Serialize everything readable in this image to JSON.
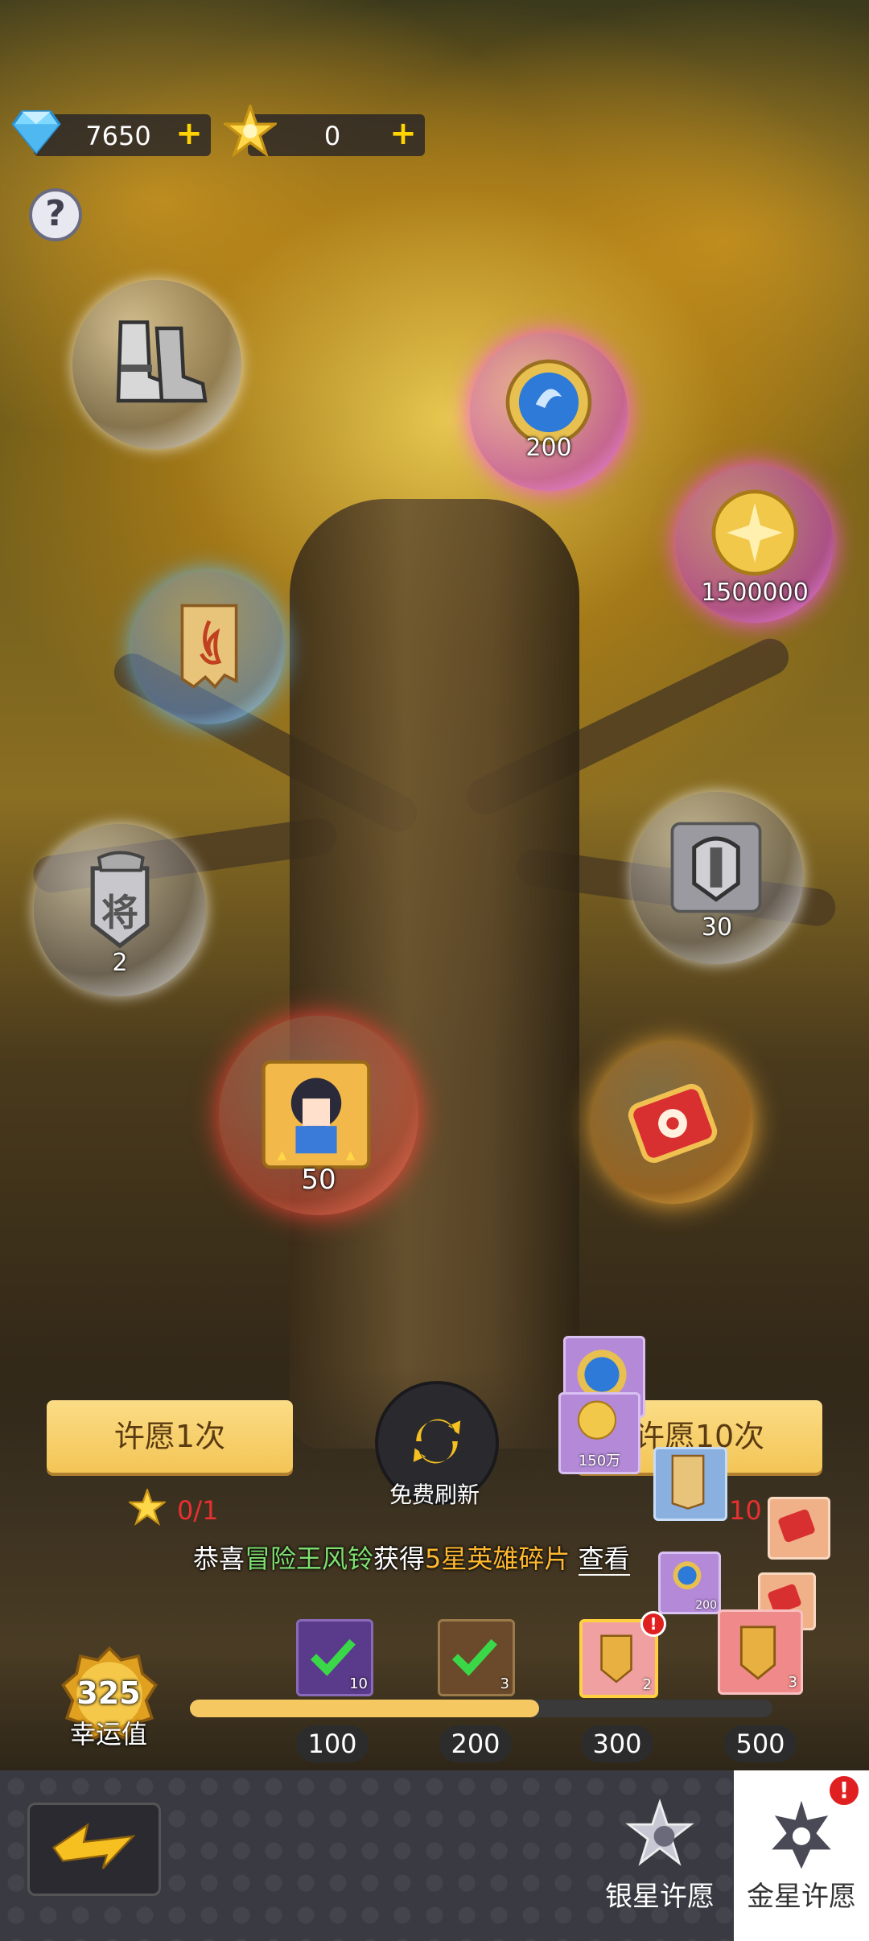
{
  "currency": {
    "diamond": {
      "value": "7650",
      "icon": "diamond-icon",
      "plus": "+"
    },
    "star": {
      "value": "0",
      "icon": "gold-star-icon",
      "plus": "+"
    }
  },
  "help": {
    "label": "?"
  },
  "bubbles": [
    {
      "name": "boots",
      "count": ""
    },
    {
      "name": "blue-medal",
      "count": "200"
    },
    {
      "name": "gold-coin",
      "count": "1500000"
    },
    {
      "name": "scroll",
      "count": ""
    },
    {
      "name": "general-token",
      "count": "2",
      "token_text": "将"
    },
    {
      "name": "helmet",
      "count": "30"
    },
    {
      "name": "hero-shard",
      "count": "50"
    },
    {
      "name": "red-ticket",
      "count": ""
    }
  ],
  "actions": {
    "wish_once": "许愿1次",
    "wish_ten": "许愿10次",
    "free_refresh": "免费刷新",
    "cost_once": "0/1",
    "cost_ten": "10"
  },
  "floating_cards": [
    {
      "name": "medal-card",
      "count": ""
    },
    {
      "name": "coin-card",
      "count": "150万"
    },
    {
      "name": "scroll-card",
      "count": ""
    },
    {
      "name": "small-medal-card",
      "count": "200"
    }
  ],
  "notice": {
    "prefix": "恭喜",
    "player": "冒险王风铃",
    "verb": "获得",
    "item": "5星英雄碎片",
    "link": "查看"
  },
  "luck": {
    "value": "325",
    "label": "幸运值",
    "progress_fraction": 0.6
  },
  "milestones": [
    {
      "threshold": "100",
      "count": "10",
      "claimed": true
    },
    {
      "threshold": "200",
      "count": "3",
      "claimed": true
    },
    {
      "threshold": "300",
      "count": "2",
      "claimed": false,
      "alert": "!"
    },
    {
      "threshold": "500",
      "count": "3",
      "claimed": false
    }
  ],
  "nav": {
    "silver_wish": "银星许愿",
    "gold_wish": "金星许愿",
    "gold_alert": "!"
  }
}
